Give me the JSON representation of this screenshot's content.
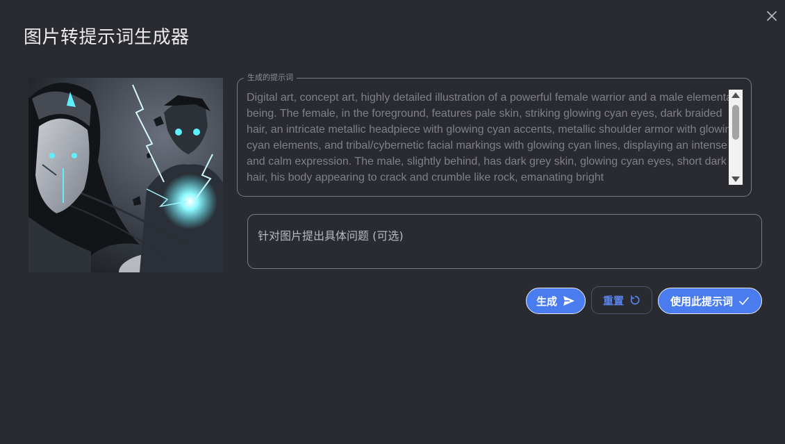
{
  "dialog": {
    "title": "图片转提示词生成器",
    "close_icon": "close-icon"
  },
  "prompt": {
    "legend": "生成的提示词",
    "text": "Digital art, concept art, highly detailed illustration of a powerful female warrior and a male elemental being. The female, in the foreground, features pale skin, striking glowing cyan eyes, dark braided hair, an intricate metallic headpiece with glowing cyan accents, metallic shoulder armor with glowing cyan elements, and tribal/cybernetic facial markings with glowing cyan lines, displaying an intense and calm expression. The male, slightly behind, has dark grey skin, glowing cyan eyes, short dark hair, his body appearing to crack and crumble like rock, emanating bright"
  },
  "question": {
    "placeholder": "针对图片提出具体问题 (可选)",
    "value": ""
  },
  "buttons": {
    "generate": "生成",
    "reset": "重置",
    "use": "使用此提示词"
  },
  "colors": {
    "background": "#2a2b30",
    "accent": "#4a7cf0",
    "border": "#7b7d84",
    "glow": "#5ff0ff"
  }
}
